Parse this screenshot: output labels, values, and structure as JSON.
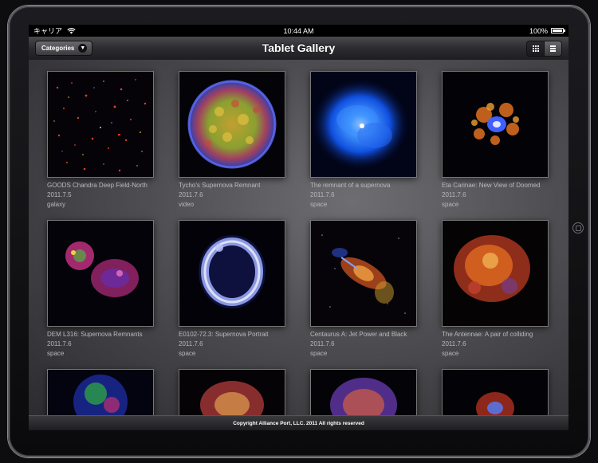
{
  "status_bar": {
    "carrier": "キャリア",
    "time": "10:44 AM",
    "battery": "100%",
    "battery_level": 1.0
  },
  "nav": {
    "title": "Tablet Gallery",
    "categories_label": "Categories",
    "view_mode": "grid"
  },
  "items": [
    {
      "title": "GOODS Chandra Deep Field-North",
      "date": "2011.7.5",
      "category": "galaxy"
    },
    {
      "title": "Tycho's Supernova Remnant",
      "date": "2011.7.6",
      "category": "video"
    },
    {
      "title": "The remnant of a supernova",
      "date": "2011.7.6",
      "category": "space"
    },
    {
      "title": "Eta Carinae: New View of Doomed",
      "date": "2011.7.6",
      "category": "space"
    },
    {
      "title": "DEM L316: Supernova Remnants",
      "date": "2011.7.6",
      "category": "space"
    },
    {
      "title": "E0102-72.3: Supernova Portrait",
      "date": "2011.7.6",
      "category": "space"
    },
    {
      "title": "Centaurus A: Jet Power and Black",
      "date": "2011.7.6",
      "category": "space"
    },
    {
      "title": "The Antennae: A pair of colliding",
      "date": "2011.7.6",
      "category": "space"
    },
    {
      "title": "",
      "date": "",
      "category": ""
    },
    {
      "title": "",
      "date": "",
      "category": ""
    },
    {
      "title": "",
      "date": "",
      "category": ""
    },
    {
      "title": "",
      "date": "",
      "category": ""
    }
  ],
  "footer": {
    "copyright": "Copyright Alliance Port, LLC. 2011 All rights reserved"
  }
}
